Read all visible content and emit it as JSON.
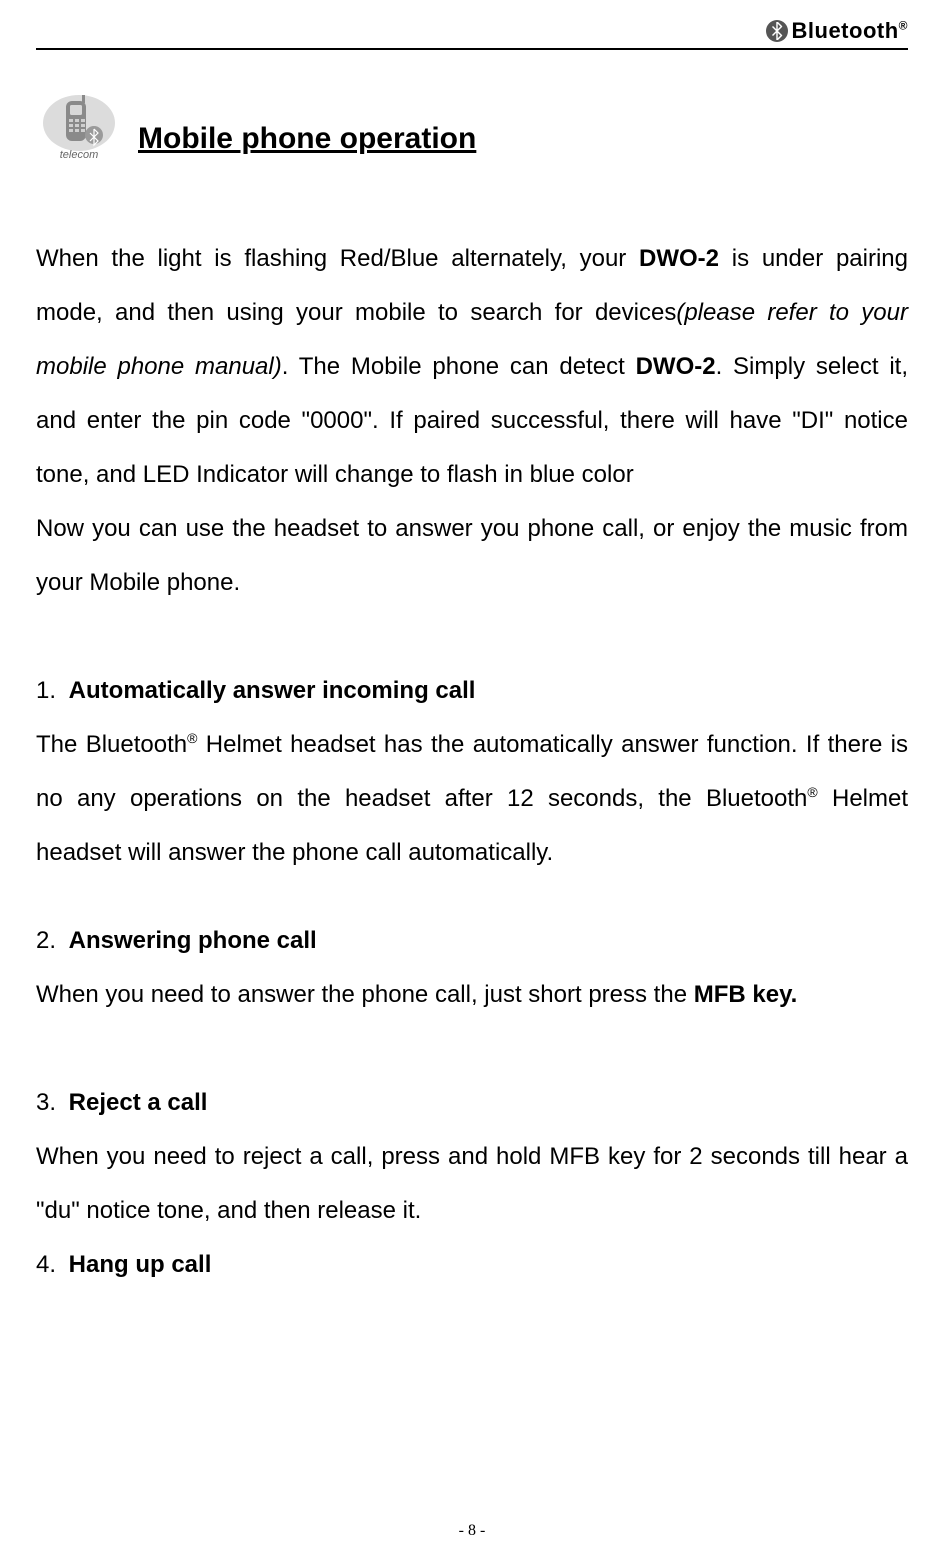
{
  "header": {
    "brand": "Bluetooth",
    "reg": "®"
  },
  "icon": {
    "label": "telecom"
  },
  "title": "Mobile phone operation",
  "intro": {
    "seg1": "When the light is flashing Red/Blue alternately, your ",
    "dwo1": "DWO-2",
    "seg2": " is under pairing mode, and then using your mobile to search for devices",
    "italic": "(please refer to your mobile phone manual)",
    "seg3": ". The Mobile phone can detect ",
    "dwo2": "DWO-2",
    "seg4": ". Simply select it, and enter the pin code \"0000\". If paired successful, there will have \"DI\" notice tone, and LED Indicator will change to flash in blue color"
  },
  "intro2": "Now you can use the headset to answer you phone call, or enjoy the music from your Mobile phone.",
  "items": [
    {
      "num": "1.",
      "title": "Automatically answer incoming call",
      "body_pre": "The Bluetooth",
      "reg": "®",
      "body_mid": " Helmet headset has the automatically answer function. If there is no any operations on the headset after 12 seconds, the Bluetooth",
      "body_post": " Helmet headset will answer the phone call automatically."
    },
    {
      "num": "2.",
      "title": "Answering phone call",
      "body_pre": "When you need to answer the phone call, just short press the ",
      "bold_tail": "MFB key."
    },
    {
      "num": "3.",
      "title": "Reject a call",
      "body": "When you need to reject a call, press and hold MFB key for 2 seconds till hear a \"du\" notice tone, and then release it."
    },
    {
      "num": "4.",
      "title": "Hang up call"
    }
  ],
  "footer": "- 8 -"
}
